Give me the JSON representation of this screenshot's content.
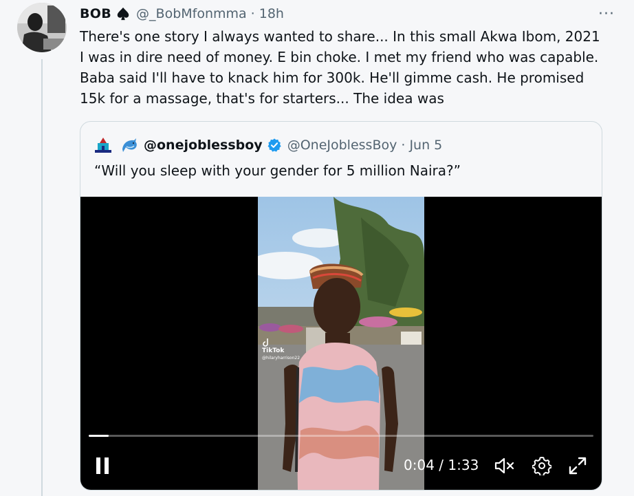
{
  "tweet": {
    "author_name": "BOB",
    "handle": "@_BobMfonmma",
    "time": "· 18h",
    "more_label": "···",
    "text": "There's one story I always wanted to share... In this small Akwa Ibom, 2021 I was in dire need of money. E bin choke. I met my friend who was capable. Baba said I'll have to knack him for 300k. He'll gimme cash. He promised 15k for a massage, that's for starters... The idea was"
  },
  "quote": {
    "name": "@onejoblessboy",
    "handle": "@OneJoblessBoy",
    "time": "· Jun 5",
    "text": "“Will you sleep with your gender for 5 million Naira?”"
  },
  "video": {
    "watermark": "TikTok",
    "watermark_user": "@hilaryharrison22",
    "current_time": "0:04",
    "time_separator": "/",
    "duration": "1:33",
    "progress": 0.04
  },
  "icons": [
    "spade-icon",
    "verified-badge-icon",
    "dolphin-icon",
    "pause-icon",
    "mute-icon",
    "settings-icon",
    "fullscreen-icon"
  ],
  "colors": {
    "text": "#0f1419",
    "secondary": "#536471",
    "verified": "#1d9bf0",
    "background": "#f6f7f9",
    "border": "#cfd9de"
  }
}
